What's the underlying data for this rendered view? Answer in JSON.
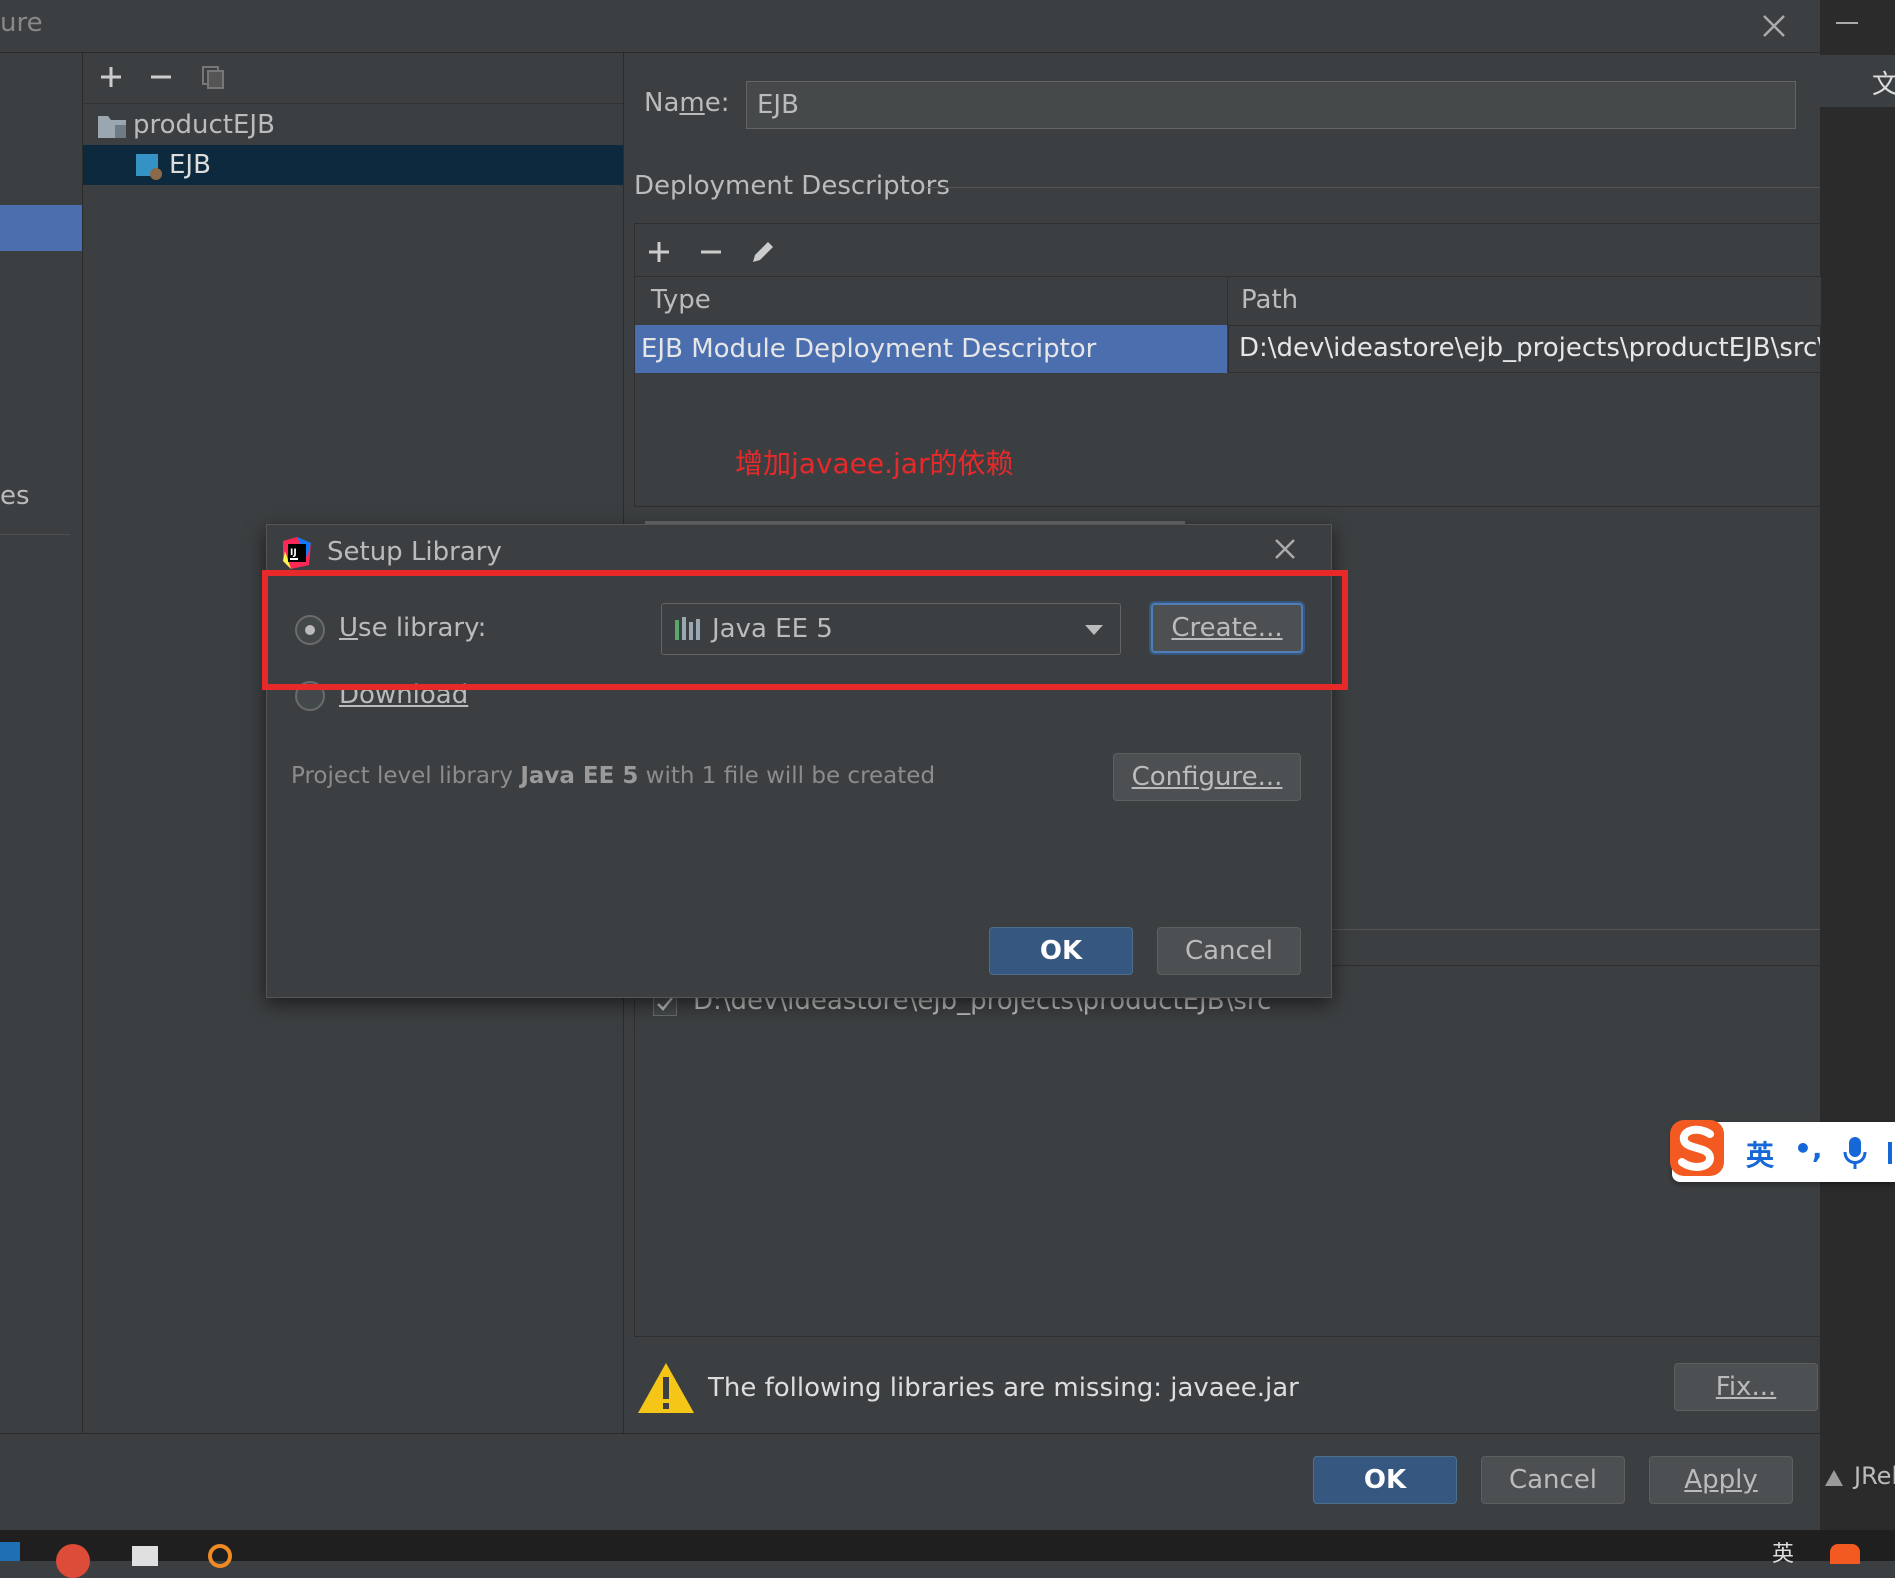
{
  "window": {
    "title_fragment": "ure"
  },
  "left_nav": {
    "item_fragment": "es"
  },
  "tree": {
    "items": [
      {
        "label": "productEJB"
      },
      {
        "label": "EJB"
      }
    ]
  },
  "facet": {
    "name_label": "Name:",
    "name_value": "EJB",
    "section_title": "Deployment Descriptors",
    "columns": [
      "Type",
      "Path"
    ],
    "rows": [
      {
        "type": "EJB Module Deployment Descriptor",
        "path": "D:\\dev\\ideastore\\ejb_projects\\productEJB\\src\\MET"
      }
    ],
    "annotation": "增加javaee.jar的依赖",
    "source_root": "D:\\dev\\ideastore\\ejb_projects\\productEJB\\src",
    "warning_text": "The following libraries are missing: javaee.jar",
    "fix_label": "Fix..."
  },
  "dialog": {
    "title": "Setup Library",
    "use_library_label": "Use library:",
    "download_label": "Download",
    "library_selected": "Java EE 5",
    "create_label": "Create...",
    "info_prefix": "Project level library ",
    "info_bold": "Java EE 5",
    "info_suffix": " with 1 file will be created",
    "configure_label": "Configure...",
    "ok_label": "OK",
    "cancel_label": "Cancel"
  },
  "footer": {
    "ok_label": "OK",
    "cancel_label": "Cancel",
    "apply_label": "Apply",
    "jrebel_fragment": "JReb"
  },
  "ime": {
    "lang": "英",
    "punct": "•,"
  },
  "right_strip": {
    "char": "文"
  },
  "taskbar": {
    "lang": "英"
  },
  "colors": {
    "background": "#3c3f41",
    "selection": "#4b6eaf",
    "tree_selection": "#0d293e",
    "primary_button": "#365880",
    "annotation_red": "#e8292a",
    "warning_yellow": "#f5c518"
  }
}
